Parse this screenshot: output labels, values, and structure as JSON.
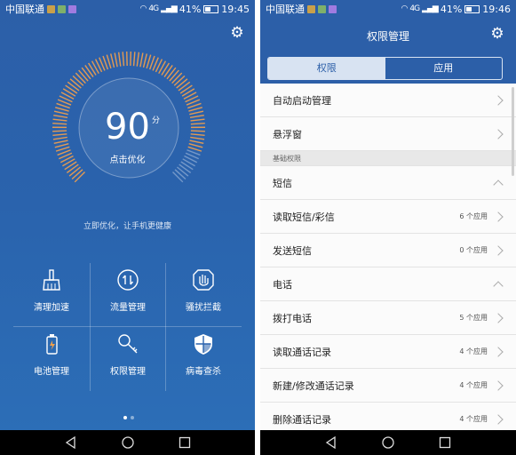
{
  "left": {
    "status": {
      "carrier": "中国联通",
      "signal": "4G",
      "battery": "41%",
      "time": "19:45"
    },
    "score": "90",
    "score_unit": "分",
    "score_fill": 0.9,
    "optimize_label": "点击优化",
    "hint": "立即优化，让手机更健康",
    "tiles": [
      {
        "label": "清理加速",
        "icon": "broom-icon"
      },
      {
        "label": "流量管理",
        "icon": "traffic-icon"
      },
      {
        "label": "骚扰拦截",
        "icon": "block-hand-icon"
      },
      {
        "label": "电池管理",
        "icon": "battery-icon"
      },
      {
        "label": "权限管理",
        "icon": "key-icon"
      },
      {
        "label": "病毒查杀",
        "icon": "shield-icon"
      }
    ],
    "page_dots": {
      "count": 2,
      "active": 0
    }
  },
  "right": {
    "status": {
      "carrier": "中国联通",
      "signal": "4G",
      "battery": "41%",
      "time": "19:46"
    },
    "title": "权限管理",
    "tabs": [
      "权限",
      "应用"
    ],
    "rows": [
      {
        "label": "自动启动管理",
        "count": "",
        "type": "item"
      },
      {
        "label": "悬浮窗",
        "count": "",
        "type": "item"
      },
      {
        "label": "基础权限",
        "count": "",
        "type": "section"
      },
      {
        "label": "短信",
        "count": "",
        "type": "group"
      },
      {
        "label": "读取短信/彩信",
        "count": "6 个应用",
        "type": "item"
      },
      {
        "label": "发送短信",
        "count": "0 个应用",
        "type": "item"
      },
      {
        "label": "电话",
        "count": "",
        "type": "group"
      },
      {
        "label": "拨打电话",
        "count": "5 个应用",
        "type": "item"
      },
      {
        "label": "读取通话记录",
        "count": "4 个应用",
        "type": "item"
      },
      {
        "label": "新建/修改通话记录",
        "count": "4 个应用",
        "type": "item"
      },
      {
        "label": "删除通话记录",
        "count": "4 个应用",
        "type": "item"
      }
    ]
  },
  "colors": {
    "primary": "#2c5fa8",
    "dial_tick": "#e39a52",
    "tab_active_bg": "#d8e3f2"
  }
}
